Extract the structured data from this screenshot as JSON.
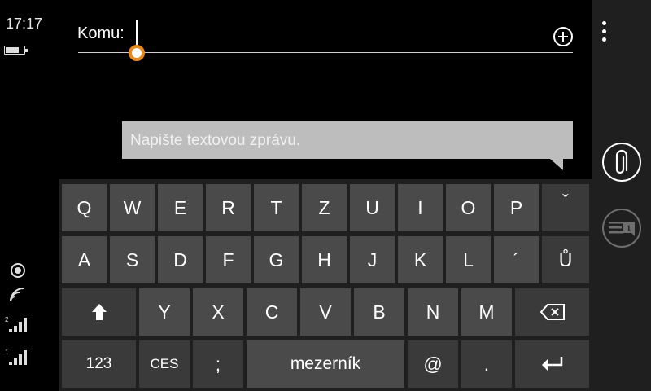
{
  "status_bar": {
    "time": "17:17"
  },
  "recipient": {
    "label": "Komu:"
  },
  "message": {
    "placeholder": "Napište textovou zprávu."
  },
  "keyboard": {
    "row1": [
      "Q",
      "W",
      "E",
      "R",
      "T",
      "Z",
      "U",
      "I",
      "O",
      "P",
      "ˇ"
    ],
    "row2": [
      "A",
      "S",
      "D",
      "F",
      "G",
      "H",
      "J",
      "K",
      "L",
      "´",
      "Ů"
    ],
    "row3_letters": [
      "Y",
      "X",
      "C",
      "V",
      "B",
      "N",
      "M"
    ],
    "row4": {
      "numbers": "123",
      "language": "CES",
      "semicolon": ";",
      "space": "mezerník",
      "at": "@",
      "period": "."
    }
  },
  "appbar": {
    "sms_badge": "1"
  },
  "icons": [
    "battery-icon",
    "location-icon",
    "wifi-icon",
    "signal-icon",
    "add-contact-icon",
    "more-icon",
    "attach-icon",
    "sms-icon",
    "shift-icon",
    "backspace-icon",
    "enter-icon"
  ]
}
